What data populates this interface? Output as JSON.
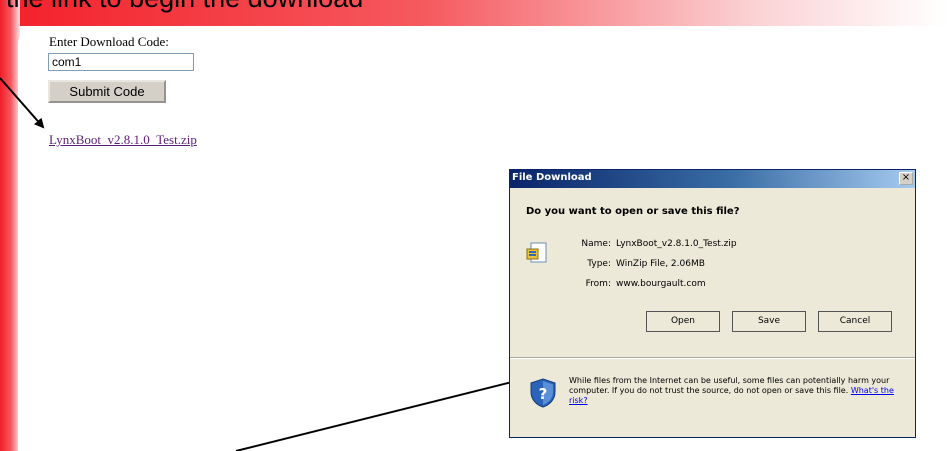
{
  "slide": {
    "caption": "the link to begin the download"
  },
  "webpage": {
    "form_label": "Enter Download Code:",
    "code_value": "com1",
    "submit_label": "Submit Code",
    "download_link": "LynxBoot_v2.8.1.0_Test.zip"
  },
  "dialog": {
    "title": "File Download",
    "close_label": "×",
    "question": "Do you want to open or save this file?",
    "fields": [
      {
        "key": "Name:",
        "value": "LynxBoot_v2.8.1.0_Test.zip"
      },
      {
        "key": "Type:",
        "value": "WinZip File, 2.06MB"
      },
      {
        "key": "From:",
        "value": "www.bourgault.com"
      }
    ],
    "buttons": {
      "open": "Open",
      "save": "Save",
      "cancel": "Cancel"
    },
    "warning_text": "While files from the Internet can be useful, some files can potentially harm your computer. If you do not trust the source, do not open or save this file.",
    "risk_link": "What's the risk?"
  },
  "icons": {
    "file": "zip-file-icon",
    "shield": "shield-question-icon"
  },
  "colors": {
    "slide_red": "#f01e28",
    "link_visited": "#5b1f7a",
    "dialog_bg": "#ece9d8",
    "titlebar_blue": "#0a246a"
  }
}
